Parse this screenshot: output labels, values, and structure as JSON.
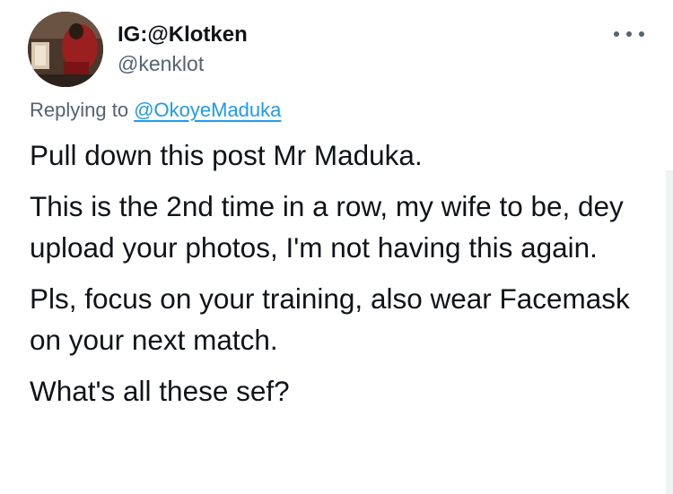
{
  "tweet": {
    "author": {
      "display_name": "IG:@Klotken",
      "handle": "@kenklot",
      "avatar_icon": "profile-photo"
    },
    "more_icon": "more-horizontal-icon",
    "replying_to": {
      "prefix": "Replying to",
      "mention": "@OkoyeMaduka"
    },
    "paragraphs": [
      "Pull down this post Mr Maduka.",
      "This is the 2nd time in a row, my wife to be, dey upload your photos, I'm not having this again.",
      "Pls, focus on your training, also wear Facemask on your next match.",
      "What's all these sef?"
    ]
  },
  "colors": {
    "text_primary": "#0f1419",
    "text_secondary": "#536471",
    "link": "#1d9bf0",
    "background": "#ffffff"
  }
}
